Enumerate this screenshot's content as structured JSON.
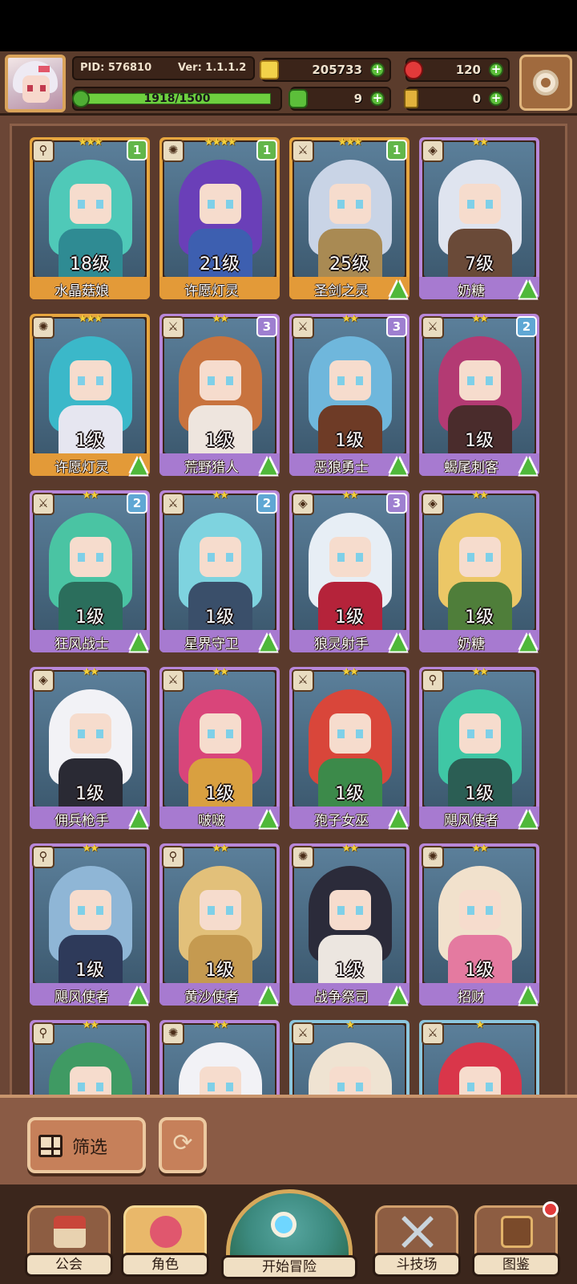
{
  "player": {
    "pid": "PID: 576810",
    "version": "Ver: 1.1.1.2",
    "xp_text": "1918/1500",
    "xp_fill": 1.0
  },
  "currencies": {
    "gold": "205733",
    "ruby": "120",
    "clover": "9",
    "key": "0"
  },
  "colors": {
    "gold_frame": "#e7a63f",
    "purple_frame": "#b887d9",
    "blue_frame": "#8cc6dd",
    "upgrade_green": "#4fb83a"
  },
  "heroes": [
    {
      "level": "18级",
      "name": "水晶菇娘",
      "stars": "★★★",
      "badge": "1",
      "badge_color": "g",
      "frame": "gold",
      "class_icon": "wand-icon",
      "upgrade": false,
      "hair": "#4fc9b8",
      "body": "#2f8b93"
    },
    {
      "level": "21级",
      "name": "许愿灯灵",
      "stars": "★★★★",
      "badge": "1",
      "badge_color": "g",
      "frame": "gold",
      "class_icon": "compass-icon",
      "upgrade": false,
      "hair": "#6a3fb8",
      "body": "#3d5fb0"
    },
    {
      "level": "25级",
      "name": "圣剑之灵",
      "stars": "★★★",
      "badge": "1",
      "badge_color": "g",
      "frame": "gold",
      "class_icon": "sword-icon",
      "upgrade": true,
      "hair": "#c9d4e6",
      "body": "#a98a53"
    },
    {
      "level": "7级",
      "name": "奶糖",
      "stars": "★★",
      "badge": "",
      "badge_color": "",
      "frame": "purple",
      "class_icon": "shield-icon",
      "upgrade": true,
      "hair": "#dfe4ef",
      "body": "#6a4a38"
    },
    {
      "level": "1级",
      "name": "许愿灯灵",
      "stars": "★★★",
      "badge": "",
      "badge_color": "",
      "frame": "gold",
      "class_icon": "compass-icon",
      "upgrade": true,
      "hair": "#3bb8c9",
      "body": "#e6e6f0"
    },
    {
      "level": "1级",
      "name": "荒野猎人",
      "stars": "★★",
      "badge": "3",
      "badge_color": "p",
      "frame": "purple",
      "class_icon": "sword-icon",
      "upgrade": true,
      "hair": "#c8733e",
      "body": "#eee5de"
    },
    {
      "level": "1级",
      "name": "恶狼勇士",
      "stars": "★★",
      "badge": "3",
      "badge_color": "p",
      "frame": "purple",
      "class_icon": "sword-icon",
      "upgrade": true,
      "hair": "#6fb7dc",
      "body": "#6e3b26"
    },
    {
      "level": "1级",
      "name": "蝎尾刺客",
      "stars": "★★",
      "badge": "2",
      "badge_color": "b",
      "frame": "purple",
      "class_icon": "sword-icon",
      "upgrade": true,
      "hair": "#b33a73",
      "body": "#4a2c2c"
    },
    {
      "level": "1级",
      "name": "狂风战士",
      "stars": "★★",
      "badge": "2",
      "badge_color": "b",
      "frame": "purple",
      "class_icon": "sword-icon",
      "upgrade": true,
      "hair": "#4ac4a3",
      "body": "#2b6e5c"
    },
    {
      "level": "1级",
      "name": "星界守卫",
      "stars": "★★",
      "badge": "2",
      "badge_color": "b",
      "frame": "purple",
      "class_icon": "sword-icon",
      "upgrade": true,
      "hair": "#7ed3df",
      "body": "#3a4f6a"
    },
    {
      "level": "1级",
      "name": "狼灵射手",
      "stars": "★★",
      "badge": "3",
      "badge_color": "p",
      "frame": "purple",
      "class_icon": "shield-icon",
      "upgrade": true,
      "hair": "#e7eef5",
      "body": "#b5233a"
    },
    {
      "level": "1级",
      "name": "奶糖",
      "stars": "★★",
      "badge": "",
      "badge_color": "",
      "frame": "purple",
      "class_icon": "shield-icon",
      "upgrade": true,
      "hair": "#ecc766",
      "body": "#4f7e3a"
    },
    {
      "level": "1级",
      "name": "佣兵枪手",
      "stars": "★★",
      "badge": "",
      "badge_color": "",
      "frame": "purple",
      "class_icon": "shield-icon",
      "upgrade": true,
      "hair": "#f2f2f6",
      "body": "#2a2a34"
    },
    {
      "level": "1级",
      "name": "啵啵",
      "stars": "★★",
      "badge": "",
      "badge_color": "",
      "frame": "purple",
      "class_icon": "sword-icon",
      "upgrade": true,
      "hair": "#d9457a",
      "body": "#d9a040"
    },
    {
      "level": "1级",
      "name": "孢子女巫",
      "stars": "★★",
      "badge": "",
      "badge_color": "",
      "frame": "purple",
      "class_icon": "sword-icon",
      "upgrade": true,
      "hair": "#d9463a",
      "body": "#3c8a4a"
    },
    {
      "level": "1级",
      "name": "飓风使者",
      "stars": "★★",
      "badge": "",
      "badge_color": "",
      "frame": "purple",
      "class_icon": "wand-icon",
      "upgrade": true,
      "hair": "#3fc7a5",
      "body": "#2b5e54"
    },
    {
      "level": "1级",
      "name": "飓风使者",
      "stars": "★★",
      "badge": "",
      "badge_color": "",
      "frame": "purple",
      "class_icon": "wand-icon",
      "upgrade": true,
      "hair": "#8fb6d6",
      "body": "#2e3a5a"
    },
    {
      "level": "1级",
      "name": "黄沙使者",
      "stars": "★★",
      "badge": "",
      "badge_color": "",
      "frame": "purple",
      "class_icon": "wand-icon",
      "upgrade": true,
      "hair": "#e2c07a",
      "body": "#c59a50"
    },
    {
      "level": "1级",
      "name": "战争祭司",
      "stars": "★★",
      "badge": "",
      "badge_color": "",
      "frame": "purple",
      "class_icon": "compass-icon",
      "upgrade": true,
      "hair": "#2b2b3a",
      "body": "#ece6e0"
    },
    {
      "level": "1级",
      "name": "招财",
      "stars": "★★",
      "badge": "",
      "badge_color": "",
      "frame": "purple",
      "class_icon": "compass-icon",
      "upgrade": true,
      "hair": "#f1e1cc",
      "body": "#e47aa0"
    },
    {
      "level": "",
      "name": "",
      "stars": "★★",
      "badge": "",
      "badge_color": "",
      "frame": "purple",
      "class_icon": "wand-icon",
      "upgrade": false,
      "hair": "#3f9a63",
      "body": "#8a5a30"
    },
    {
      "level": "",
      "name": "",
      "stars": "★★",
      "badge": "",
      "badge_color": "",
      "frame": "purple",
      "class_icon": "compass-icon",
      "upgrade": false,
      "hair": "#f2f2f6",
      "body": "#5a8a3a"
    },
    {
      "level": "",
      "name": "",
      "stars": "★",
      "badge": "",
      "badge_color": "",
      "frame": "blue",
      "class_icon": "sword-icon",
      "upgrade": false,
      "hair": "#efe3d2",
      "body": "#6b4a30"
    },
    {
      "level": "",
      "name": "",
      "stars": "★",
      "badge": "",
      "badge_color": "",
      "frame": "blue",
      "class_icon": "sword-icon",
      "upgrade": false,
      "hair": "#d9364a",
      "body": "#6b3a30"
    }
  ],
  "filter": {
    "label": "筛选"
  },
  "nav": {
    "guild": "公会",
    "character": "角色",
    "adventure": "开始冒险",
    "arena": "斗技场",
    "codex": "图鉴"
  }
}
